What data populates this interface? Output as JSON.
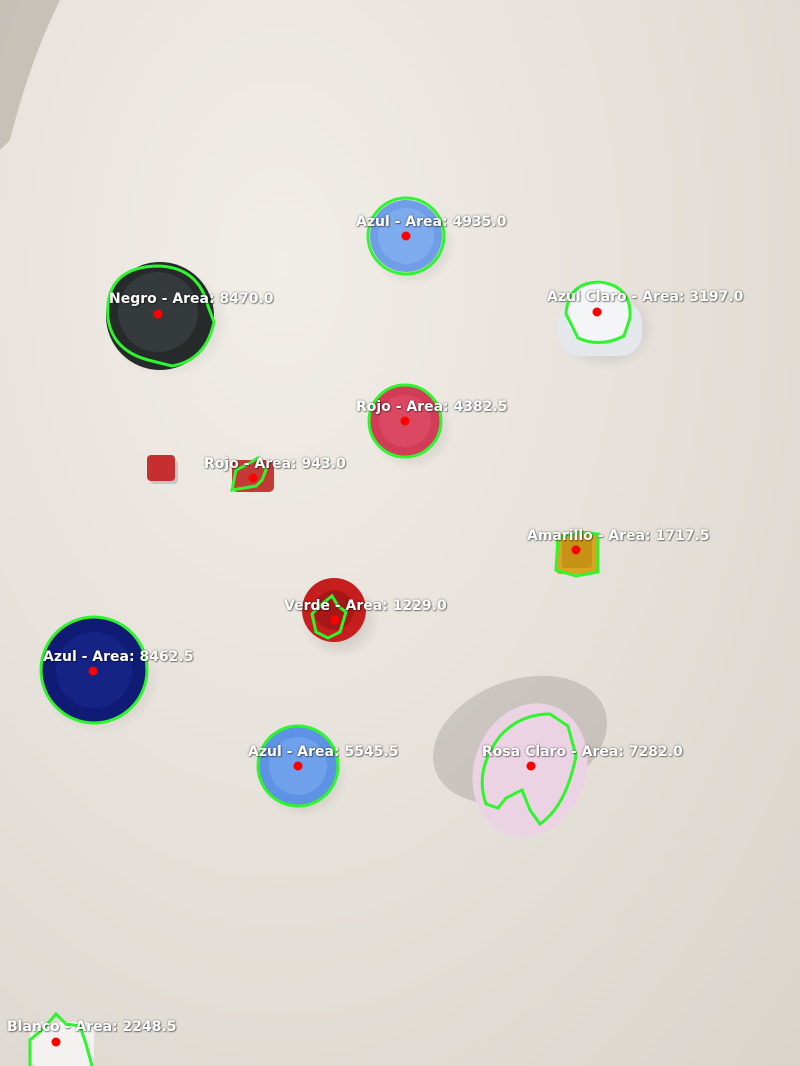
{
  "colors": {
    "contour": "#2ef52e",
    "centroid": "#ff0000",
    "label_text": "#ffffff"
  },
  "objects": [
    {
      "label": "Azul - Area: 4935.0"
    },
    {
      "label": "Negro - Area: 8470.0"
    },
    {
      "label": "Azul Claro - Area: 3197.0"
    },
    {
      "label": "Rojo - Area: 4382.5"
    },
    {
      "label": "Rojo - Area: 943.0"
    },
    {
      "label": "Amarillo - Area: 1717.5"
    },
    {
      "label": "Verde - Area: 1229.0"
    },
    {
      "label": "Azul - Area: 8462.5"
    },
    {
      "label": "Azul - Area: 5545.5"
    },
    {
      "label": "Rosa Claro - Area: 7282.0"
    },
    {
      "label": "Blanco - Area: 2248.5"
    }
  ]
}
